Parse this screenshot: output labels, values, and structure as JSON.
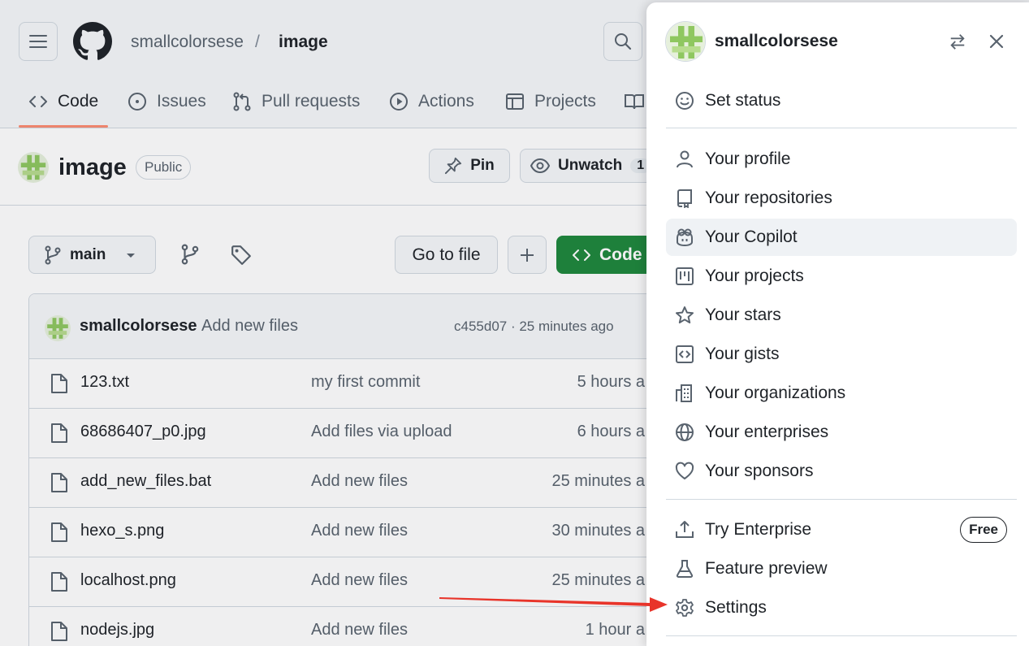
{
  "header": {
    "owner": "smallcolorsese",
    "separator": "/",
    "repo": "image",
    "tabs": [
      {
        "label": "Code",
        "icon": "code-icon",
        "active": true
      },
      {
        "label": "Issues",
        "icon": "issue-icon"
      },
      {
        "label": "Pull requests",
        "icon": "pull-request-icon"
      },
      {
        "label": "Actions",
        "icon": "play-icon"
      },
      {
        "label": "Projects",
        "icon": "table-icon"
      }
    ]
  },
  "repo": {
    "name": "image",
    "visibility": "Public",
    "pin_label": "Pin",
    "watch_label": "Unwatch",
    "watch_count": "1"
  },
  "toolbar": {
    "branch": "main",
    "go_to_file": "Go to file",
    "code_label": "Code"
  },
  "commit": {
    "author": "smallcolorsese",
    "message": "Add new files",
    "meta": "c455d07 · 25 minutes ago"
  },
  "files": [
    {
      "name": "123.txt",
      "message": "my first commit",
      "time": "5 hours a"
    },
    {
      "name": "68686407_p0.jpg",
      "message": "Add files via upload",
      "time": "6 hours a"
    },
    {
      "name": "add_new_files.bat",
      "message": "Add new files",
      "time": "25 minutes a"
    },
    {
      "name": "hexo_s.png",
      "message": "Add new files",
      "time": "30 minutes a"
    },
    {
      "name": "localhost.png",
      "message": "Add new files",
      "time": "25 minutes a"
    },
    {
      "name": "nodejs.jpg",
      "message": "Add new files",
      "time": "1 hour a"
    }
  ],
  "panel": {
    "username": "smallcolorsese",
    "status_item": {
      "label": "Set status",
      "icon": "smiley-icon"
    },
    "items": [
      {
        "label": "Your profile",
        "icon": "person-icon"
      },
      {
        "label": "Your repositories",
        "icon": "repo-icon"
      },
      {
        "label": "Your Copilot",
        "icon": "copilot-icon"
      },
      {
        "label": "Your projects",
        "icon": "project-icon"
      },
      {
        "label": "Your stars",
        "icon": "star-icon"
      },
      {
        "label": "Your gists",
        "icon": "code-square-icon"
      },
      {
        "label": "Your organizations",
        "icon": "organization-icon"
      },
      {
        "label": "Your enterprises",
        "icon": "globe-icon"
      },
      {
        "label": "Your sponsors",
        "icon": "heart-icon"
      }
    ],
    "bottom_items": [
      {
        "label": "Try Enterprise",
        "icon": "upload-icon",
        "badge": "Free"
      },
      {
        "label": "Feature preview",
        "icon": "beaker-icon"
      },
      {
        "label": "Settings",
        "icon": "gear-icon"
      }
    ]
  },
  "colors": {
    "accent_underline": "#fd8c73",
    "code_button": "#1f883d",
    "annotation_arrow": "#e8342a"
  }
}
